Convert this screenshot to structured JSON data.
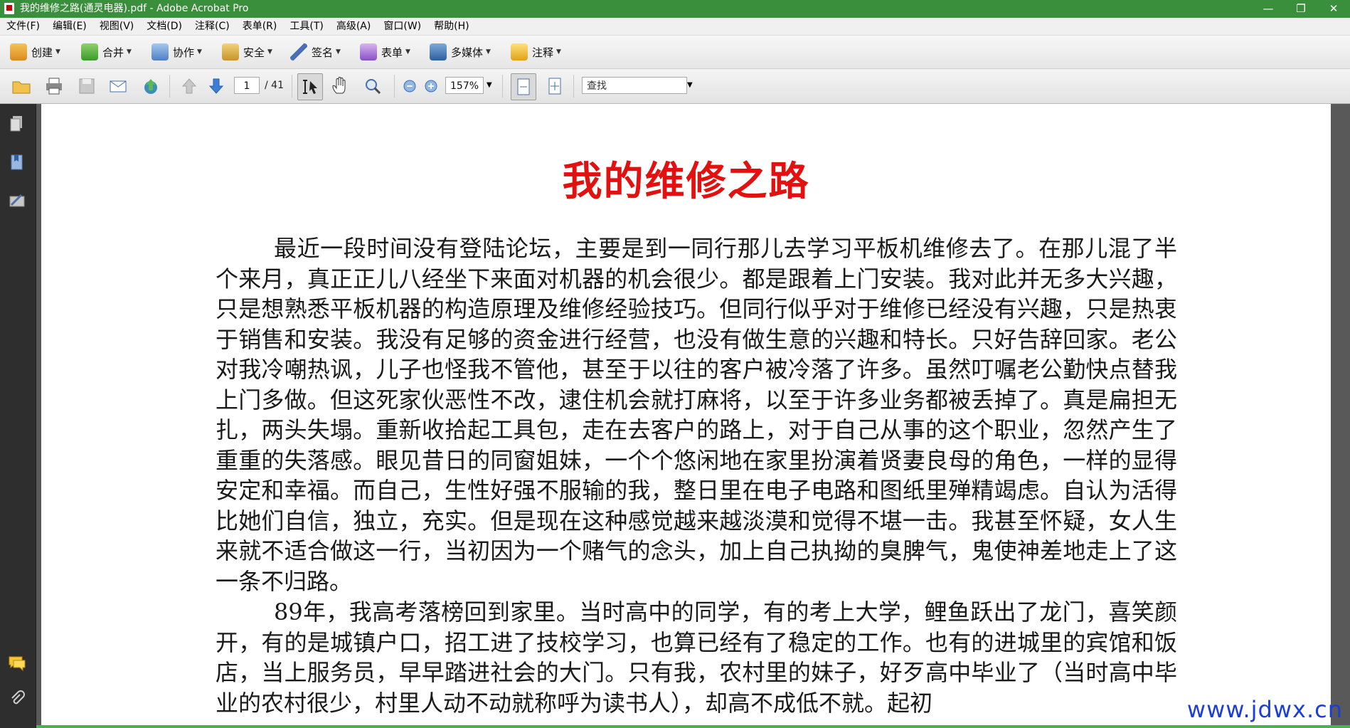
{
  "window": {
    "title": "我的维修之路(通灵电器).pdf - Adobe Acrobat Pro",
    "controls": [
      "—",
      "❐",
      "✕"
    ]
  },
  "menu": [
    "文件(F)",
    "编辑(E)",
    "视图(V)",
    "文档(D)",
    "注释(C)",
    "表单(R)",
    "工具(T)",
    "高级(A)",
    "窗口(W)",
    "帮助(H)"
  ],
  "tasks": [
    {
      "label": "创建",
      "icon": "create-icon"
    },
    {
      "label": "合并",
      "icon": "merge-icon"
    },
    {
      "label": "协作",
      "icon": "collaborate-icon"
    },
    {
      "label": "安全",
      "icon": "lock-icon"
    },
    {
      "label": "签名",
      "icon": "pen-icon"
    },
    {
      "label": "表单",
      "icon": "form-icon"
    },
    {
      "label": "多媒体",
      "icon": "multimedia-icon"
    },
    {
      "label": "注释",
      "icon": "comment-icon"
    }
  ],
  "toolbar": {
    "page_current": "1",
    "page_total": "/ 41",
    "zoom": "157%",
    "search_placeholder": "查找"
  },
  "document": {
    "title": "我的维修之路",
    "paragraphs": [
      "最近一段时间没有登陆论坛，主要是到一同行那儿去学习平板机维修去了。在那儿混了半个来月，真正正儿八经坐下来面对机器的机会很少。都是跟着上门安装。我对此并无多大兴趣，只是想熟悉平板机器的构造原理及维修经验技巧。但同行似乎对于维修已经没有兴趣，只是热衷于销售和安装。我没有足够的资金进行经营，也没有做生意的兴趣和特长。只好告辞回家。老公对我冷嘲热讽，儿子也怪我不管他，甚至于以往的客户被冷落了许多。虽然叮嘱老公勤快点替我上门多做。但这死家伙恶性不改，逮住机会就打麻将，以至于许多业务都被丢掉了。真是扁担无扎，两头失塌。重新收拾起工具包，走在去客户的路上，对于自己从事的这个职业，忽然产生了重重的失落感。眼见昔日的同窗姐妹，一个个悠闲地在家里扮演着贤妻良母的角色，一样的显得安定和幸福。而自己，生性好强不服输的我，整日里在电子电路和图纸里殚精竭虑。自认为活得比她们自信，独立，充实。但是现在这种感觉越来越淡漠和觉得不堪一击。我甚至怀疑，女人生来就不适合做这一行，当初因为一个赌气的念头，加上自己执拗的臭脾气，鬼使神差地走上了这一条不归路。",
      "89年，我高考落榜回到家里。当时高中的同学，有的考上大学，鲤鱼跃出了龙门，喜笑颜开，有的是城镇户口，招工进了技校学习，也算已经有了稳定的工作。也有的进城里的宾馆和饭店，当上服务员，早早踏进社会的大门。只有我，农村里的妹子，好歹高中毕业了（当时高中毕业的农村很少，村里人动不动就称呼为读书人），却高不成低不就。起初"
    ]
  },
  "watermark": "www.jdwx.cn",
  "colors": {
    "titlebar": "#3a8f3c",
    "doc_title": "#e31010",
    "watermark": "#1b3fd6"
  }
}
